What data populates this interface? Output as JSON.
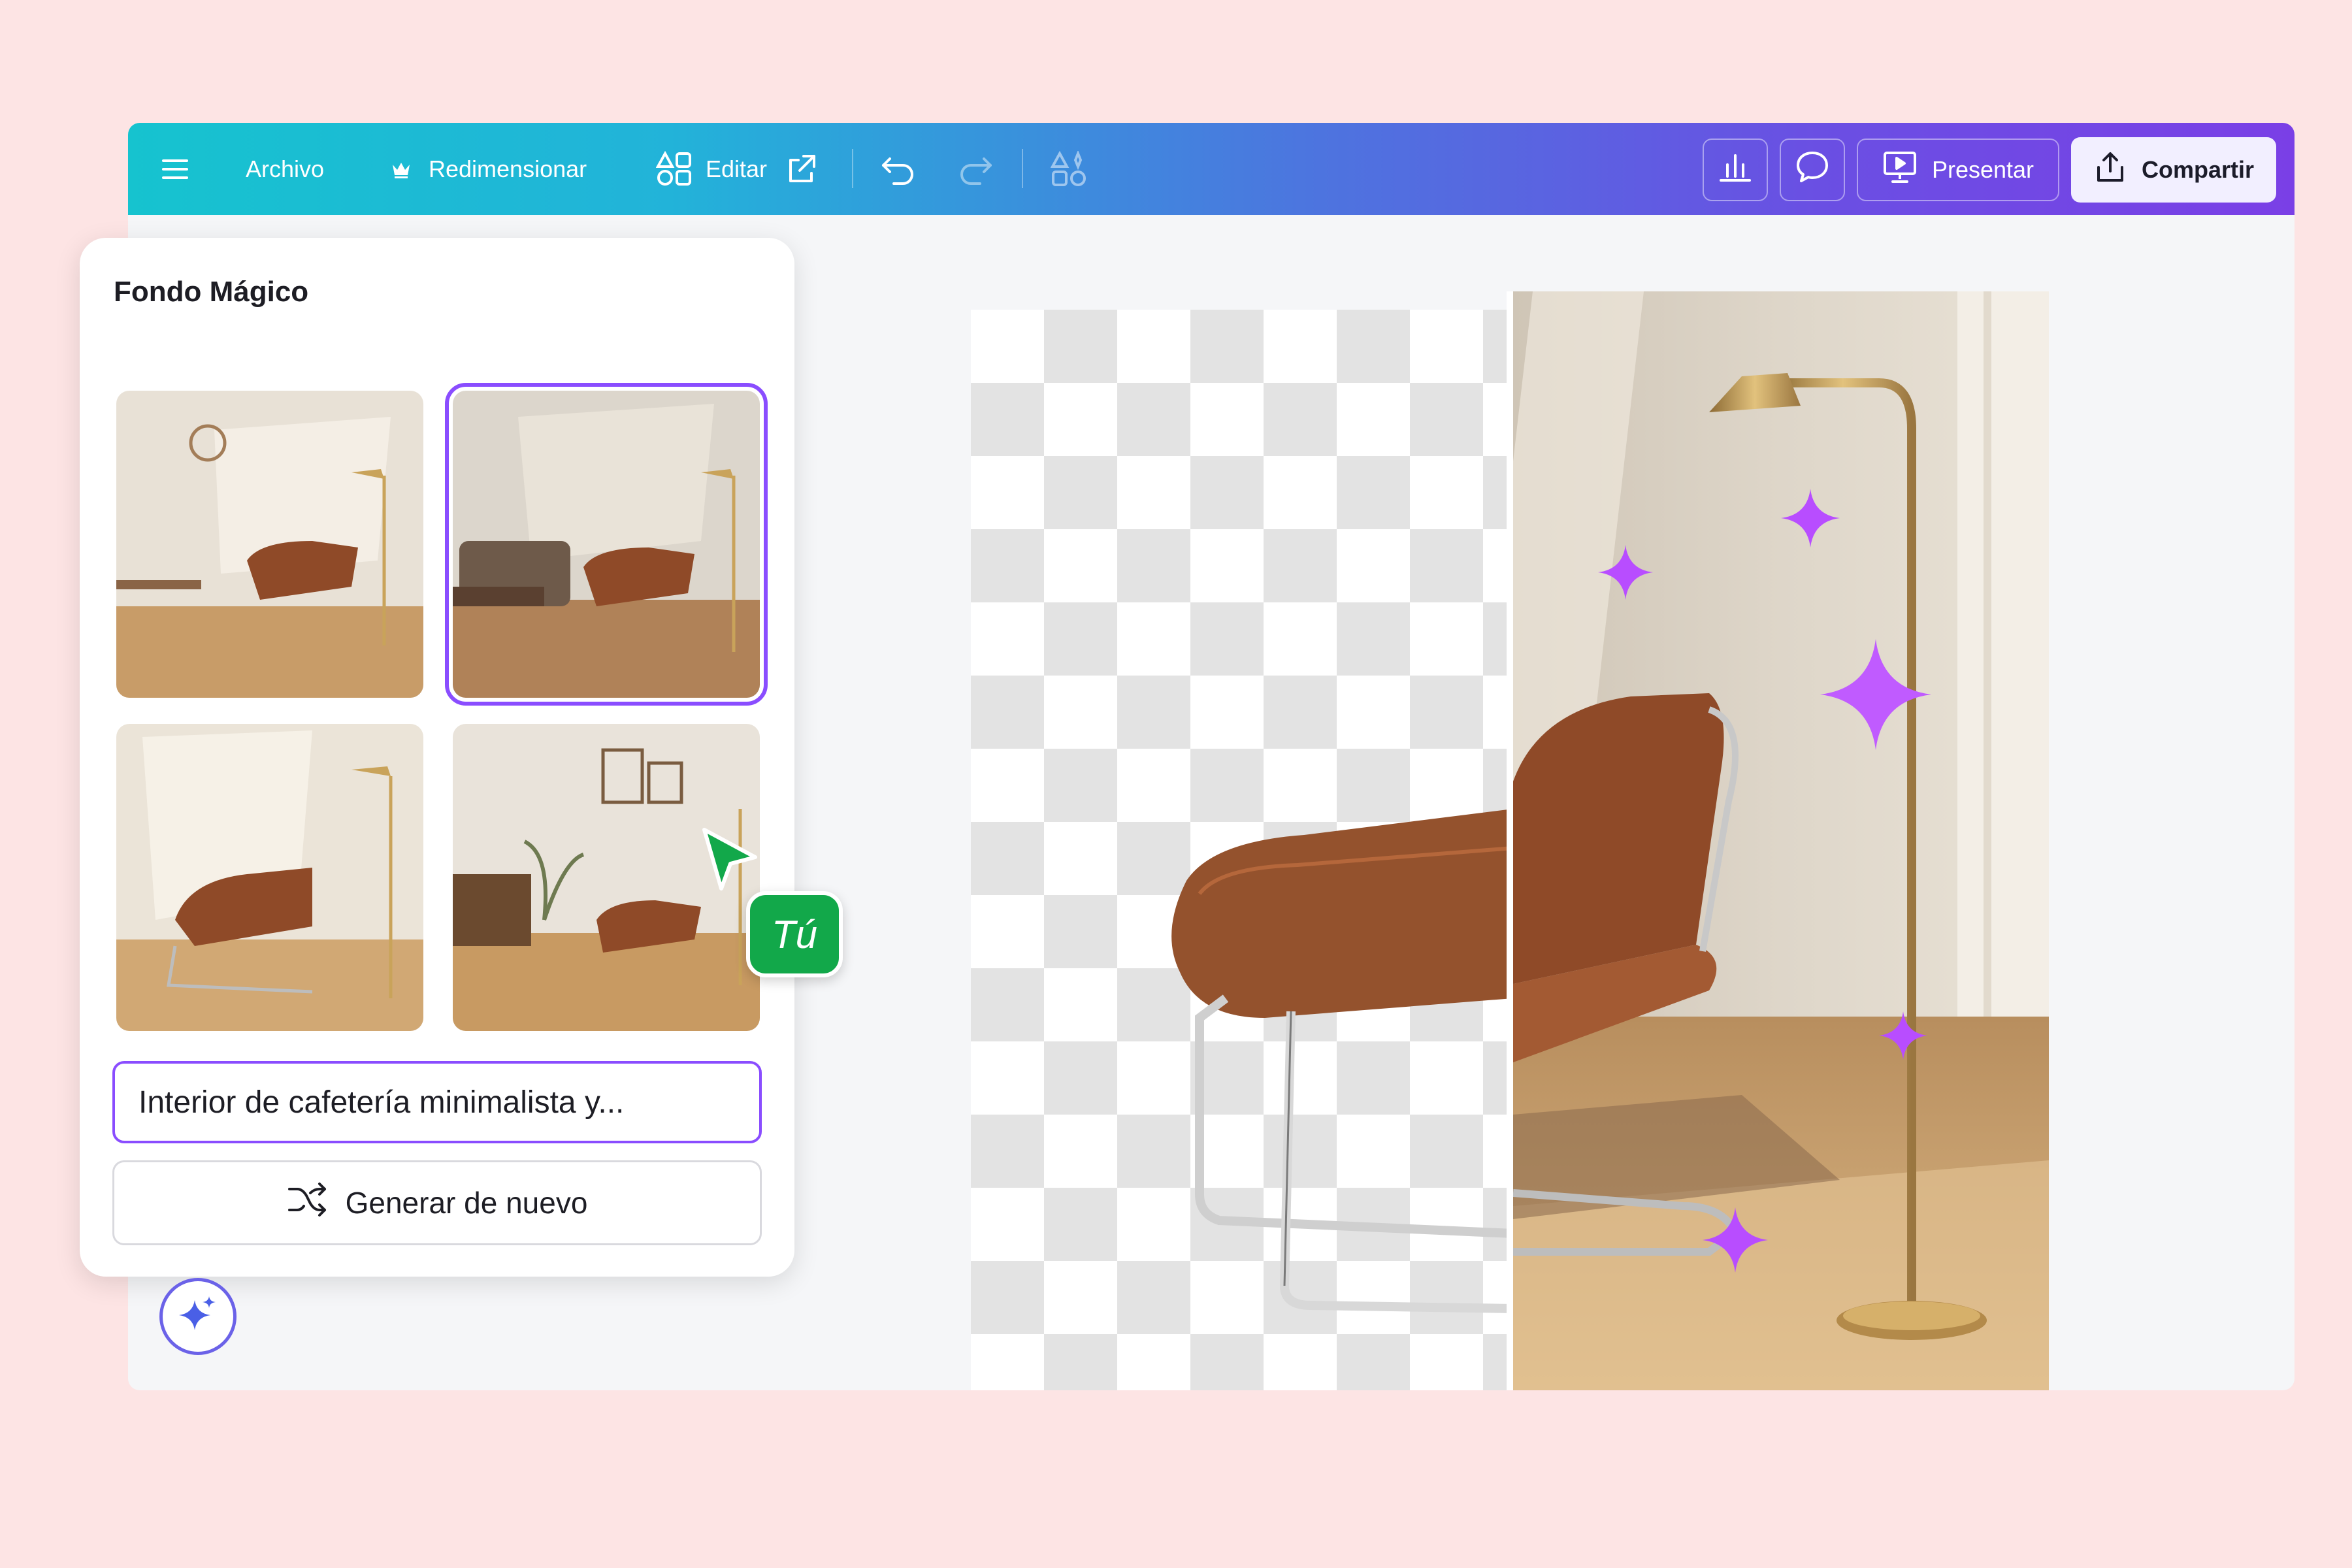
{
  "toolbar": {
    "file_label": "Archivo",
    "resize_label": "Redimensionar",
    "edit_label": "Editar",
    "present_label": "Presentar",
    "share_label": "Compartir"
  },
  "panel": {
    "title": "Fondo Mágico",
    "prompt_value": "Interior de cafetería minimalista y...",
    "regenerate_label": "Generar de nuevo",
    "selected_thumbnail": 2,
    "thumbnail_count": 4
  },
  "collaborator": {
    "label": "Tú",
    "color": "#12a84a"
  },
  "colors": {
    "accent": "#8a4dff",
    "toolbar_start": "#16c3cf",
    "toolbar_end": "#7a3fe6",
    "background": "#fde4e4",
    "sparkle": "#b84dff"
  },
  "icons": {
    "menu": "hamburger-icon",
    "resize": "crown-icon",
    "edit": "shapes-icon",
    "external": "external-link-icon",
    "undo": "undo-icon",
    "redo": "redo-icon",
    "elements": "elements-icon",
    "insights": "bar-chart-icon",
    "comment": "comment-icon",
    "present": "present-icon",
    "share": "share-icon",
    "shuffle": "shuffle-icon",
    "magic": "sparkle-icon"
  }
}
